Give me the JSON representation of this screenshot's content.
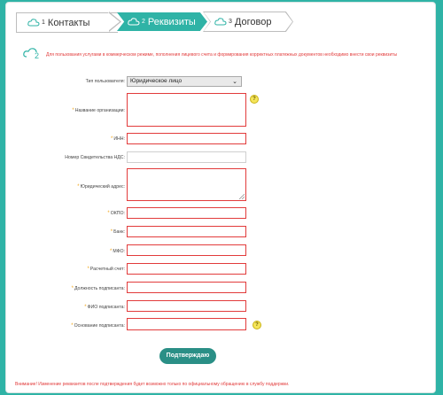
{
  "stepper": {
    "steps": [
      {
        "num": "1",
        "label": "Контакты"
      },
      {
        "num": "2",
        "label": "Реквизиты"
      },
      {
        "num": "3",
        "label": "Договор"
      }
    ]
  },
  "notice": {
    "num": "2",
    "text": "Для пользования услугами в коммерческом режиме, пополнения лицевого счета и формирования корректных платежных документов необходимо внести свои реквизиты"
  },
  "form": {
    "user_type_label": "Тип пользователя:",
    "user_type_value": "Юридическое лицо",
    "org_name_label": "Название организации:",
    "inn_label": "ИНН:",
    "vat_cert_label": "Номер Свидетельства НДС:",
    "legal_address_label": "Юридический адрес:",
    "okpo_label": "ОКПО:",
    "bank_label": "Банк:",
    "mfo_label": "МФО:",
    "account_label": "Расчетный счет:",
    "signer_position_label": "Должность подписанта:",
    "signer_name_label": "ФИО подписанта:",
    "signer_basis_label": "Основание подписанта:",
    "required_mark": "*",
    "help_mark": "?"
  },
  "confirm_button": "Подтверждаю",
  "warning": "Внимание! Изменение реквизитов после подтверждения будет возможно только по официальному обращению в службу поддержки.",
  "colors": {
    "accent": "#2fb3a6",
    "error": "#e23b3b",
    "required": "#f2a51a"
  }
}
